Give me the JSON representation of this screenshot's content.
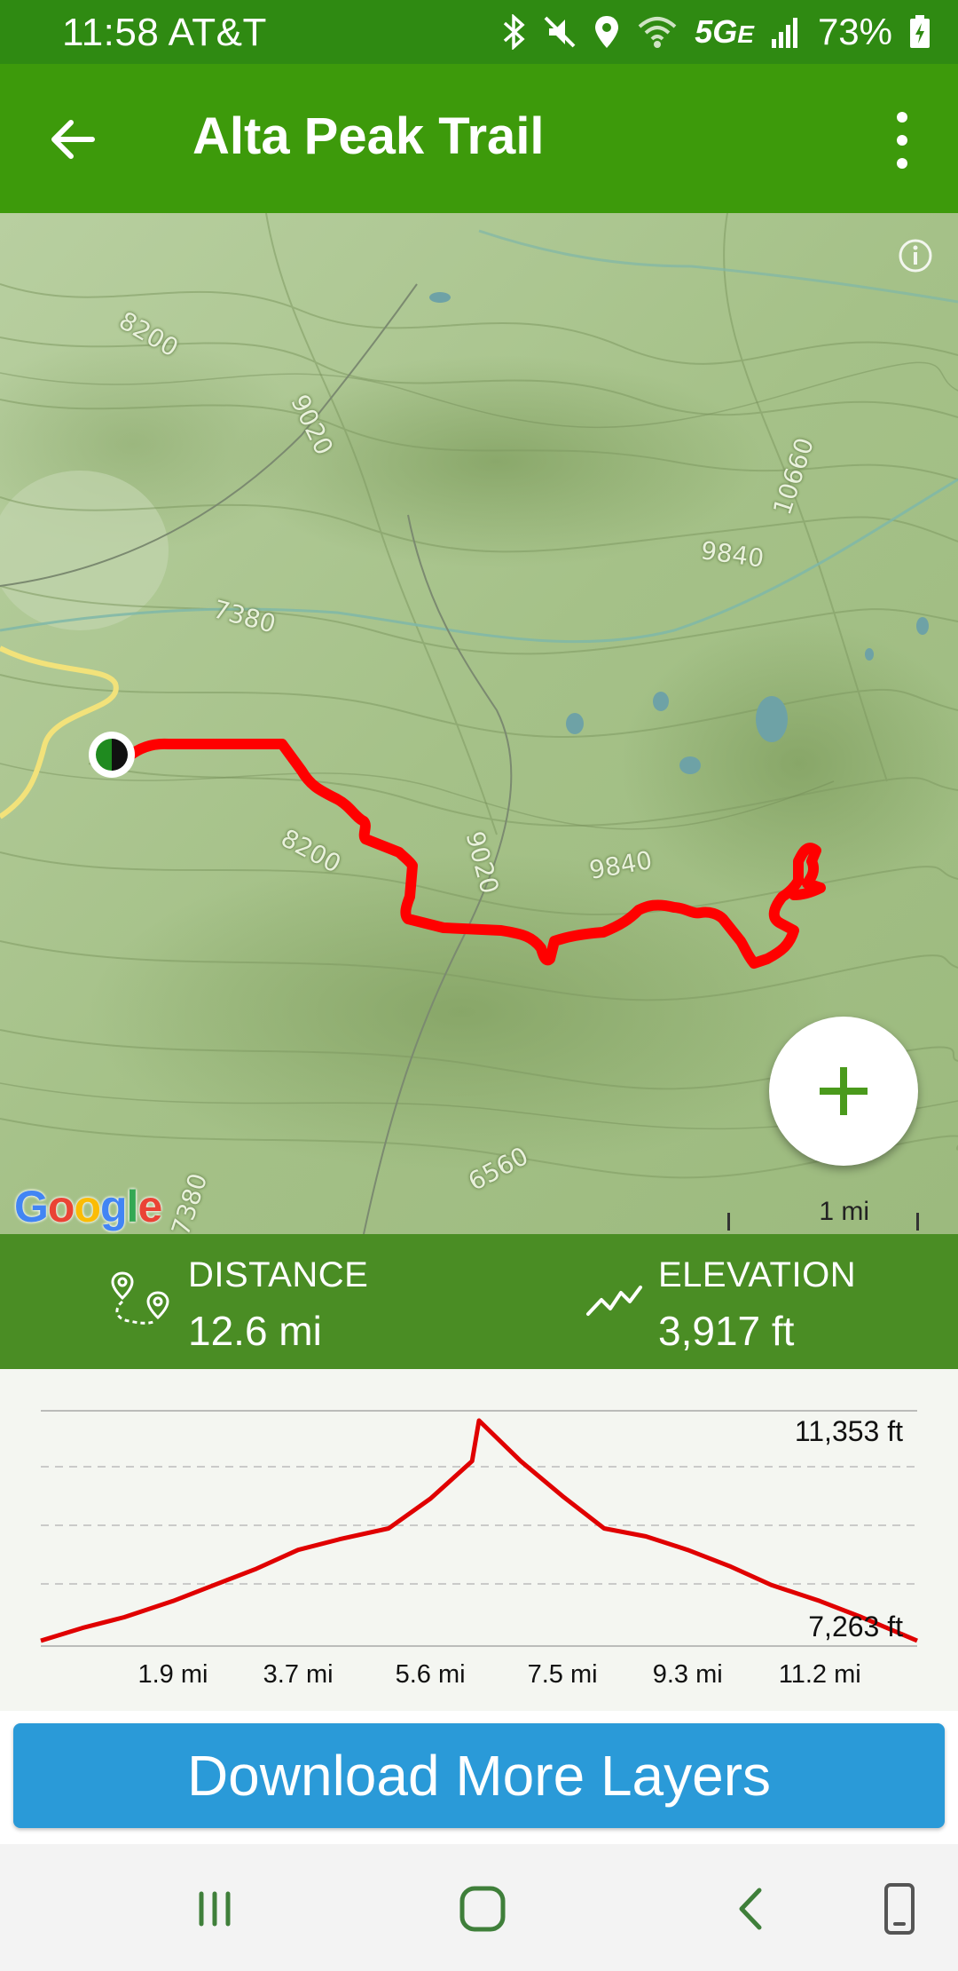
{
  "status_bar": {
    "time": "11:58",
    "carrier": "AT&T",
    "network": "5G",
    "network_sub": "E",
    "battery": "73%",
    "icons": [
      "bluetooth-icon",
      "mute-icon",
      "location-icon",
      "wifi-icon",
      "signal-icon",
      "battery-charging-icon"
    ]
  },
  "app_bar": {
    "title": "Alta Peak Trail",
    "back_icon": "arrow-left-icon",
    "menu_icon": "more-vertical-icon"
  },
  "map": {
    "contour_labels": [
      "8200",
      "9020",
      "10660",
      "9840",
      "7380",
      "8200",
      "9020",
      "9840",
      "6560",
      "7380"
    ],
    "logo": "Google",
    "scale": "1 mi",
    "zoom_icon": "plus-icon",
    "info_icon": "info-icon",
    "trail_color": "#ff0000",
    "road_color": "#f2e27a"
  },
  "stats": {
    "distance_label": "DISTANCE",
    "distance_value": "12.6 mi",
    "elevation_label": "ELEVATION",
    "elevation_value": "3,917 ft"
  },
  "chart_data": {
    "type": "line",
    "title": "",
    "xlabel": "",
    "ylabel": "",
    "x_tick_labels": [
      "1.9 mi",
      "3.7 mi",
      "5.6 mi",
      "7.5 mi",
      "9.3 mi",
      "11.2 mi"
    ],
    "y_tick_labels": [
      "11,353 ft",
      "7,263 ft"
    ],
    "xlim": [
      0,
      12.6
    ],
    "ylim": [
      7263,
      11353
    ],
    "series": [
      {
        "color": "#e00000",
        "x": [
          0,
          0.6,
          1.2,
          1.9,
          2.5,
          3.1,
          3.7,
          4.3,
          5.0,
          5.6,
          6.2,
          6.3,
          6.9,
          7.5,
          8.1,
          8.7,
          9.3,
          9.9,
          10.5,
          11.2,
          11.8,
          12.6
        ],
        "y": [
          7263,
          7500,
          7700,
          8000,
          8300,
          8600,
          8950,
          9150,
          9350,
          9900,
          10600,
          11353,
          10600,
          9950,
          9350,
          9200,
          8950,
          8650,
          8300,
          8000,
          7700,
          7263
        ]
      }
    ],
    "grid": true
  },
  "download_button": {
    "label": "Download More Layers"
  },
  "nav_bar": {
    "icons": [
      "recent-apps-icon",
      "home-icon",
      "back-icon",
      "rotate-screen-icon"
    ]
  }
}
